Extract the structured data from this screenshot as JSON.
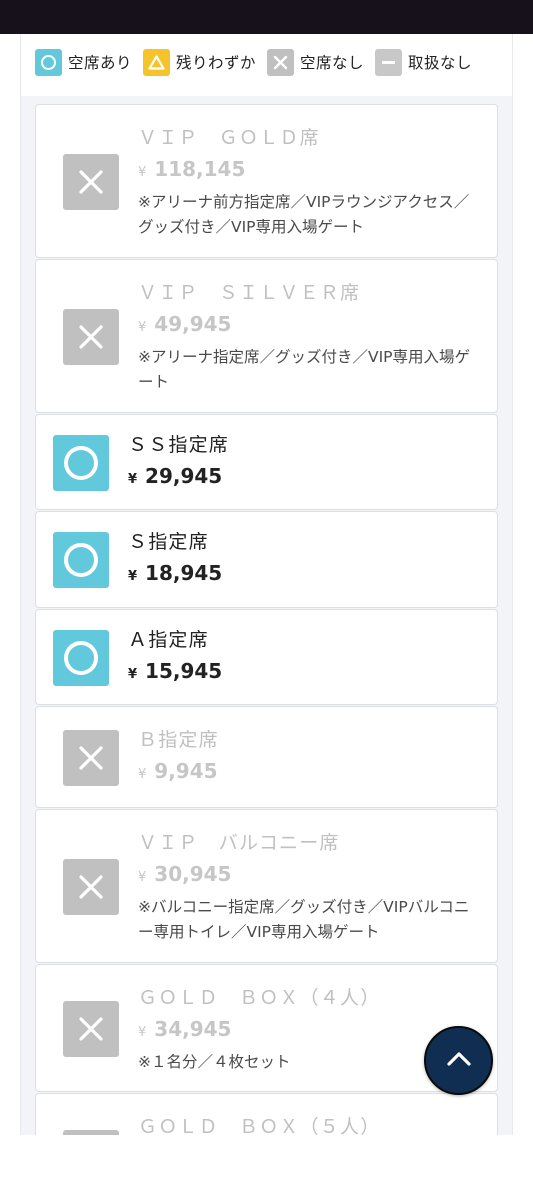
{
  "legend": [
    {
      "label": "空席あり",
      "icon": "circle-icon"
    },
    {
      "label": "残りわずか",
      "icon": "triangle-icon"
    },
    {
      "label": "空席なし",
      "icon": "cross-icon"
    },
    {
      "label": "取扱なし",
      "icon": "dash-icon"
    }
  ],
  "tickets": [
    {
      "name": "ＶＩＰ　ＧＯＬＤ席",
      "yen": "¥",
      "price": "118,145",
      "note": "※アリーナ前方指定席／VIPラウンジアクセス／グッズ付き／VIP専用入場ゲート",
      "status": "sold-out"
    },
    {
      "name": "ＶＩＰ　ＳＩＬＶＥＲ席",
      "yen": "¥",
      "price": "49,945",
      "note": "※アリーナ指定席／グッズ付き／VIP専用入場ゲート",
      "status": "sold-out"
    },
    {
      "name": "ＳＳ指定席",
      "yen": "¥",
      "price": "29,945",
      "note": "",
      "status": "available"
    },
    {
      "name": "Ｓ指定席",
      "yen": "¥",
      "price": "18,945",
      "note": "",
      "status": "available"
    },
    {
      "name": "Ａ指定席",
      "yen": "¥",
      "price": "15,945",
      "note": "",
      "status": "available"
    },
    {
      "name": "Ｂ指定席",
      "yen": "¥",
      "price": "9,945",
      "note": "",
      "status": "sold-out"
    },
    {
      "name": "ＶＩＰ　バルコニー席",
      "yen": "¥",
      "price": "30,945",
      "note": "※バルコニー指定席／グッズ付き／VIPバルコニー専用トイレ／VIP専用入場ゲート",
      "status": "sold-out"
    },
    {
      "name": "ＧＯＬＤ　ＢＯＸ（４人）",
      "yen": "¥",
      "price": "34,945",
      "note": "※１名分／４枚セット",
      "status": "sold-out"
    },
    {
      "name": "ＧＯＬＤ　ＢＯＸ（５人）",
      "yen": "",
      "price": "",
      "note": "",
      "status": "sold-out"
    }
  ],
  "scroll_top_icon": "chevron-up-icon",
  "colors": {
    "available": "#62c9dc",
    "few": "#f5c42b",
    "sold_out": "#c0c0c0",
    "scroll_button": "#0f2e52"
  }
}
